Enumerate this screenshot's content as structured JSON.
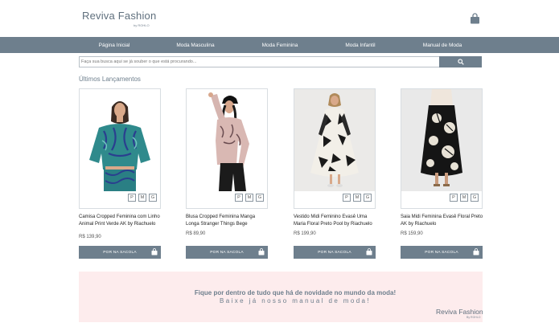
{
  "brand": {
    "name": "Reviva Fashion",
    "tagline": "by ROHLO"
  },
  "nav": {
    "items": [
      "Página Inicial",
      "Moda Masculina",
      "Moda Feminina",
      "Moda Infantil",
      "Manual de Moda"
    ]
  },
  "search": {
    "placeholder": "Faça sua busca aqui se já souber o que está procurando..."
  },
  "section": {
    "title": "Últimos Lançamentos"
  },
  "sizes": [
    "P",
    "M",
    "G"
  ],
  "cart_label": "POR NA SACOLA",
  "products": [
    {
      "name": "Camisa Cropped Feminina com Linho Animal Print Verde AK by Riachuelo",
      "price": "R$ 139,90"
    },
    {
      "name": "Blusa Cropped Feminina Manga Longa Stranger Things Bege",
      "price": "R$ 89,90"
    },
    {
      "name": "Vestido Midi Feminino Evasê Uma Maria Floral Preto Pool by Riachuelo",
      "price": "R$ 199,90"
    },
    {
      "name": "Saia Midi Feminina Evasê Floral Preto AK by Riachuelo",
      "price": "R$ 159,90"
    }
  ],
  "banner": {
    "line1": "Fique por dentro de tudo que há de novidade no mundo da moda!",
    "line2": "Baixe já nosso manual de moda!",
    "brand": "Reviva Fashion",
    "tagline": "By ROHLO"
  },
  "colors": {
    "primary": "#6e7f8d",
    "banner_bg": "#fdeced"
  },
  "icons": {
    "cart": "shopping-bag-icon",
    "search": "search-icon"
  }
}
